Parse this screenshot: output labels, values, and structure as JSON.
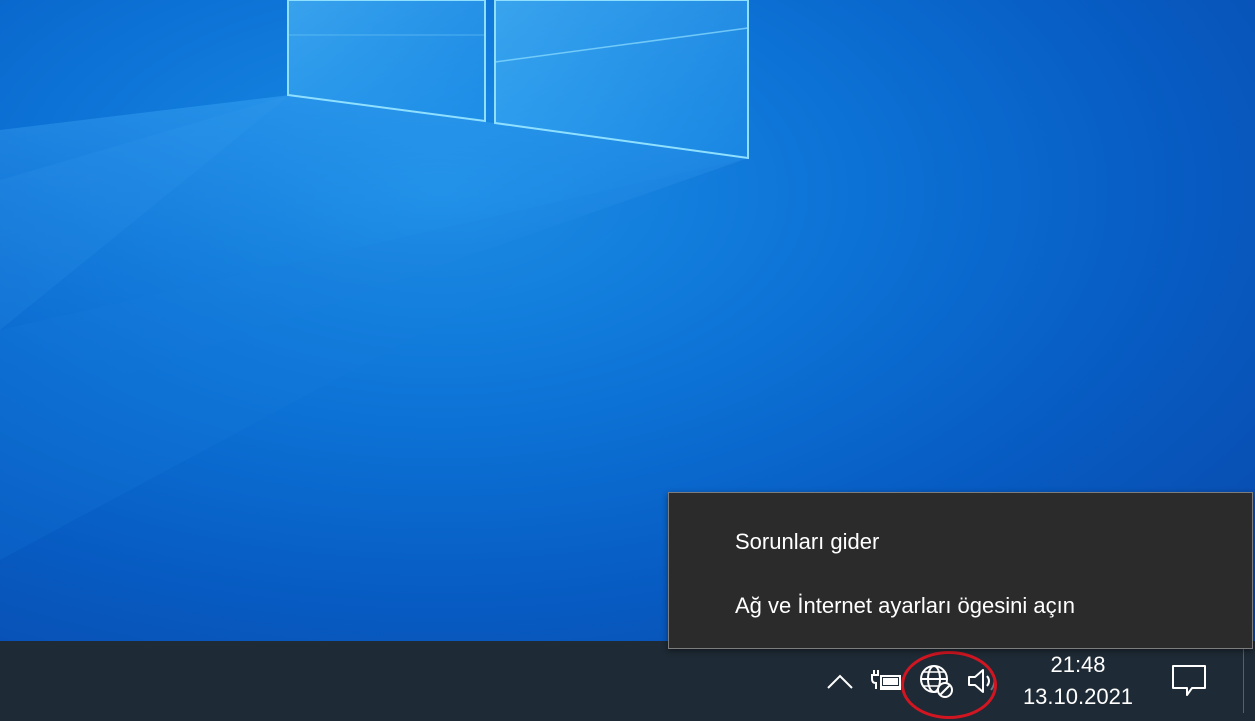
{
  "context_menu": {
    "items": [
      {
        "label": "Sorunları gider"
      },
      {
        "label": "Ağ ve İnternet ayarları ögesini açın"
      }
    ]
  },
  "taskbar": {
    "tray_icons": [
      {
        "name": "chevron-up-icon"
      },
      {
        "name": "power-plug-battery-icon"
      },
      {
        "name": "network-globe-disconnected-icon"
      },
      {
        "name": "speaker-volume-icon"
      }
    ],
    "clock": {
      "time": "21:48",
      "date": "13.10.2021"
    },
    "notification_icon": "speech-bubble-icon"
  },
  "colors": {
    "taskbar": "#1e2a35",
    "menu_background": "#2b2b2b",
    "menu_border": "#7d7d7d",
    "highlight_ring": "#d11622",
    "wallpaper_blue": "#0d73d6"
  }
}
